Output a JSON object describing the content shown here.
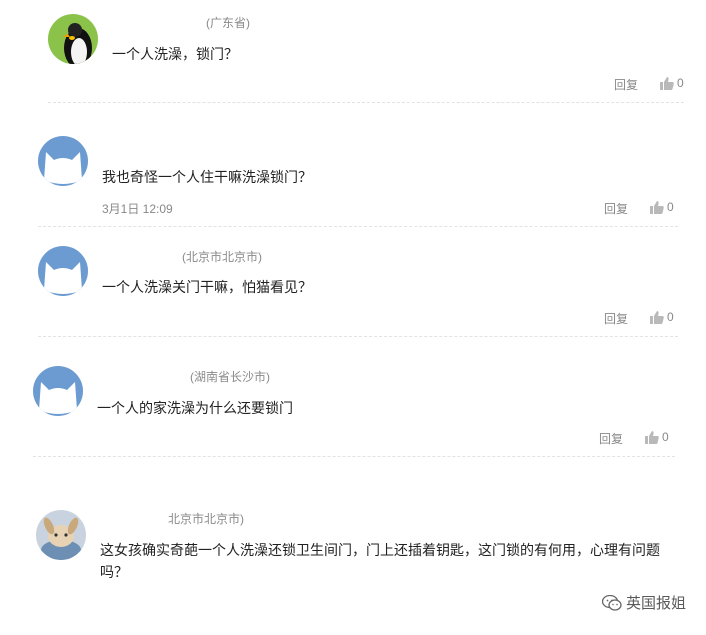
{
  "comments": [
    {
      "avatar": "penguin-avatar",
      "location": "(广东省)",
      "text": "一个人洗澡，锁门？",
      "date": "",
      "reply_label": "回复",
      "likes": "0"
    },
    {
      "avatar": "default-avatar",
      "location": "",
      "text": "我也奇怪一个人住干嘛洗澡锁门？",
      "date": "3月1日 12:09",
      "reply_label": "回复",
      "likes": "0"
    },
    {
      "avatar": "default-avatar",
      "location": "(北京市北京市)",
      "text": "一个人洗澡关门干嘛，怕猫看见？",
      "date": "",
      "reply_label": "回复",
      "likes": "0"
    },
    {
      "avatar": "default-avatar",
      "location": "(湖南省长沙市)",
      "text": "一个人的家洗澡为什么还要锁门",
      "date": "",
      "reply_label": "回复",
      "likes": "0"
    },
    {
      "avatar": "rabbit-avatar",
      "location": "北京市北京市)",
      "text": "这女孩确实奇葩一个人洗澡还锁卫生间门，门上还插着钥匙，这门锁的有何用，心理有问题吗？",
      "date": "",
      "reply_label": "",
      "likes": ""
    }
  ],
  "icons": {
    "like": "thumbs-up-icon",
    "watermark": "wechat-icon"
  },
  "watermark": {
    "text": "英国报姐"
  },
  "colors": {
    "default_avatar": "#6b9bd1",
    "divider": "#e3e3e3",
    "meta_text": "#888888"
  }
}
